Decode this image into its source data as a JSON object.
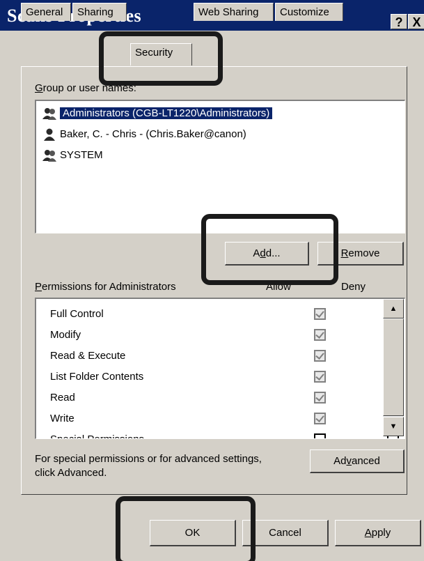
{
  "window": {
    "title": "Scans Properties",
    "help_label": "?",
    "close_label": "X"
  },
  "tabs": [
    {
      "label": "General"
    },
    {
      "label": "Sharing"
    },
    {
      "label": "Security",
      "active": true
    },
    {
      "label": "Web Sharing"
    },
    {
      "label": "Customize"
    }
  ],
  "security": {
    "group_label_pre": "",
    "group_label_accel": "G",
    "group_label_post": "roup or user names:",
    "users": [
      {
        "name": "Administrators (CGB-LT1220\\Administrators)",
        "icon": "group-icon",
        "selected": true
      },
      {
        "name": "Baker, C. - Chris - (Chris.Baker@canon)",
        "icon": "user-icon",
        "selected": false
      },
      {
        "name": "SYSTEM",
        "icon": "group-icon",
        "selected": false
      }
    ],
    "add_pre": "A",
    "add_accel": "d",
    "add_post": "d...",
    "remove_accel": "R",
    "remove_post": "emove",
    "perm_label_accel": "P",
    "perm_label_post": "ermissions for Administrators",
    "col_allow": "Allow",
    "col_deny": "Deny",
    "permissions": [
      {
        "name": "Full Control",
        "allow": true,
        "deny": false
      },
      {
        "name": "Modify",
        "allow": true,
        "deny": false
      },
      {
        "name": "Read & Execute",
        "allow": true,
        "deny": false
      },
      {
        "name": "List Folder Contents",
        "allow": true,
        "deny": false
      },
      {
        "name": "Read",
        "allow": true,
        "deny": false
      },
      {
        "name": "Write",
        "allow": true,
        "deny": false
      },
      {
        "name": "Special Permissions",
        "allow": false,
        "deny": false
      }
    ],
    "advanced_text_line1": "For special permissions or for advanced settings,",
    "advanced_text_line2": "click Advanced.",
    "advanced_pre": "Ad",
    "advanced_accel": "v",
    "advanced_post": "anced"
  },
  "footer": {
    "ok_label": "OK",
    "cancel_label": "Cancel",
    "apply_accel": "A",
    "apply_post": "pply"
  },
  "colors": {
    "titlebar": "#0a246a",
    "dialog_face": "#d4d0c8",
    "selection": "#0a246a",
    "callout_border": "#1a1a1a"
  }
}
